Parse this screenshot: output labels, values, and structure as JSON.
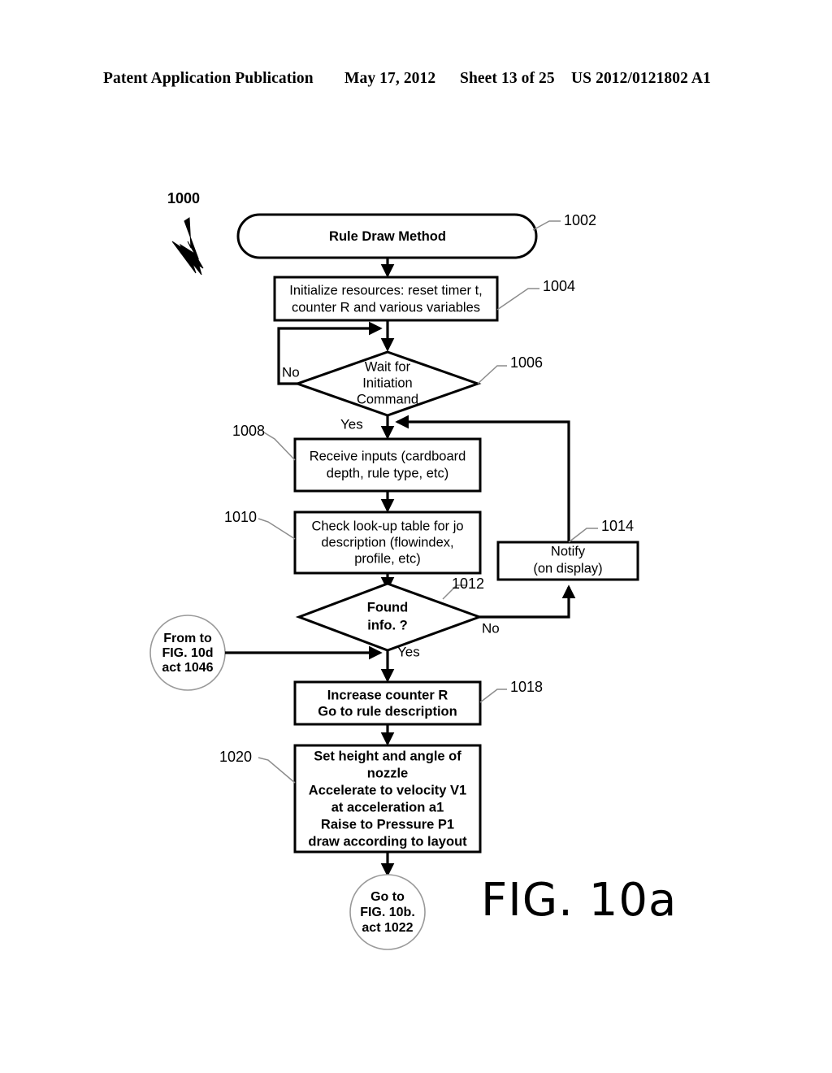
{
  "header": {
    "publication": "Patent Application Publication",
    "date": "May 17, 2012",
    "sheet": "Sheet 13 of 25",
    "patent_number": "US 2012/0121802 A1"
  },
  "figure": {
    "label": "FIG. 10a",
    "diagram_ref": "1000",
    "type": "flowchart"
  },
  "nodes": {
    "start": {
      "ref": "1002",
      "shape": "rounded-rectangle",
      "lines": [
        "Rule Draw Method"
      ]
    },
    "initialize": {
      "ref": "1004",
      "shape": "rectangle",
      "lines": [
        "Initialize resources: reset timer t,",
        "counter R and various variables"
      ]
    },
    "wait": {
      "ref": "1006",
      "shape": "diamond",
      "lines": [
        "Wait for",
        "Initiation",
        "Command"
      ],
      "branch_no": "No",
      "branch_yes": "Yes"
    },
    "receive": {
      "ref": "1008",
      "shape": "rectangle",
      "lines": [
        "Receive inputs (cardboard",
        "depth, rule type, etc)"
      ]
    },
    "lookup": {
      "ref": "1010",
      "shape": "rectangle",
      "lines": [
        "Check look-up table for jo",
        "description (flowindex,",
        "profile, etc)"
      ]
    },
    "found": {
      "ref": "1012",
      "shape": "diamond",
      "lines": [
        "Found",
        "info. ?"
      ],
      "branch_no": "No",
      "branch_yes": "Yes"
    },
    "notify": {
      "ref": "1014",
      "shape": "rectangle",
      "lines": [
        "Notify",
        "(on display)"
      ]
    },
    "increase": {
      "ref": "1018",
      "shape": "rectangle",
      "lines": [
        "Increase counter R",
        "Go to rule description"
      ]
    },
    "set_nozzle": {
      "ref": "1020",
      "shape": "rectangle",
      "lines": [
        "Set height and angle of",
        "nozzle",
        "Accelerate to velocity V1",
        "at acceleration a1",
        "Raise to Pressure P1",
        "draw according to layout"
      ]
    },
    "from_connector": {
      "shape": "circle",
      "lines": [
        "From to",
        "FIG. 10d",
        "act 1046"
      ]
    },
    "goto_connector": {
      "shape": "circle",
      "lines": [
        "Go to",
        "FIG. 10b.",
        "act 1022"
      ]
    }
  },
  "colors": {
    "ink": "#000000",
    "paper": "#ffffff",
    "leader": "#8c8c8c"
  }
}
